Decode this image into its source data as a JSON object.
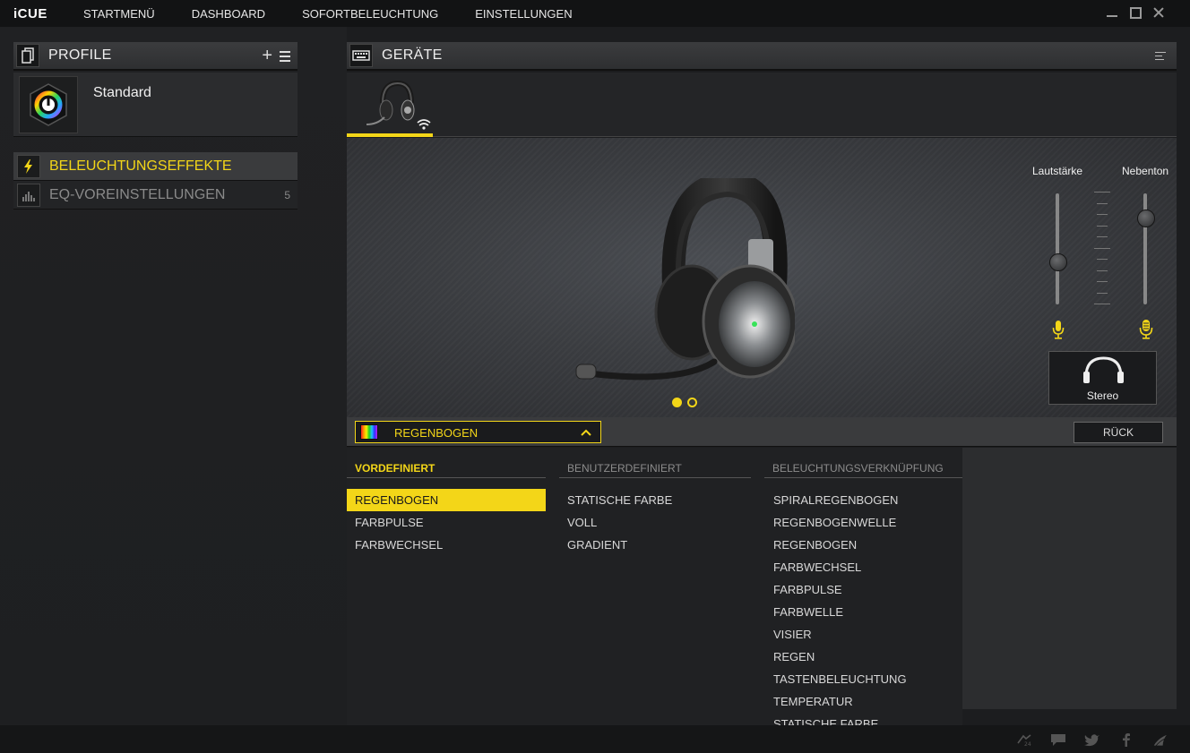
{
  "app": {
    "logo": "iCUE",
    "nav": [
      "STARTMENÜ",
      "DASHBOARD",
      "SOFORTBELEUCHTUNG",
      "EINSTELLUNGEN"
    ]
  },
  "profiles": {
    "title": "PROFILE",
    "add_label": "+",
    "current": {
      "name": "Standard"
    }
  },
  "sidebar": {
    "lighting_label": "BELEUCHTUNGSEFFEKTE",
    "eq_label": "EQ-VOREINSTELLUNGEN",
    "eq_count": "5"
  },
  "devices": {
    "title": "GERÄTE",
    "headset_controls": {
      "volume_label": "Lautstärke",
      "sidetone_label": "Nebenton",
      "volume_level": 0.35,
      "sidetone_level": 0.8,
      "mode_label": "Stereo"
    }
  },
  "effect": {
    "selected": "REGENBOGEN",
    "back_label": "RÜCK",
    "columns": [
      {
        "title": "VORDEFINIERT",
        "items": [
          "REGENBOGEN",
          "FARBPULSE",
          "FARBWECHSEL"
        ]
      },
      {
        "title": "BENUTZERDEFINIERT",
        "items": [
          "STATISCHE FARBE",
          "VOLL",
          "GRADIENT"
        ]
      },
      {
        "title": "BELEUCHTUNGSVERKNÜPFUNG",
        "items": [
          "SPIRALREGENBOGEN",
          "REGENBOGENWELLE",
          "REGENBOGEN",
          "FARBWECHSEL",
          "FARBPULSE",
          "FARBWELLE",
          "VISIER",
          "REGEN",
          "TASTENBELEUCHTUNG",
          "TEMPERATUR",
          "STATISCHE FARBE"
        ]
      }
    ]
  },
  "colors": {
    "accent": "#f3d618",
    "background": "#1c1d1f"
  }
}
